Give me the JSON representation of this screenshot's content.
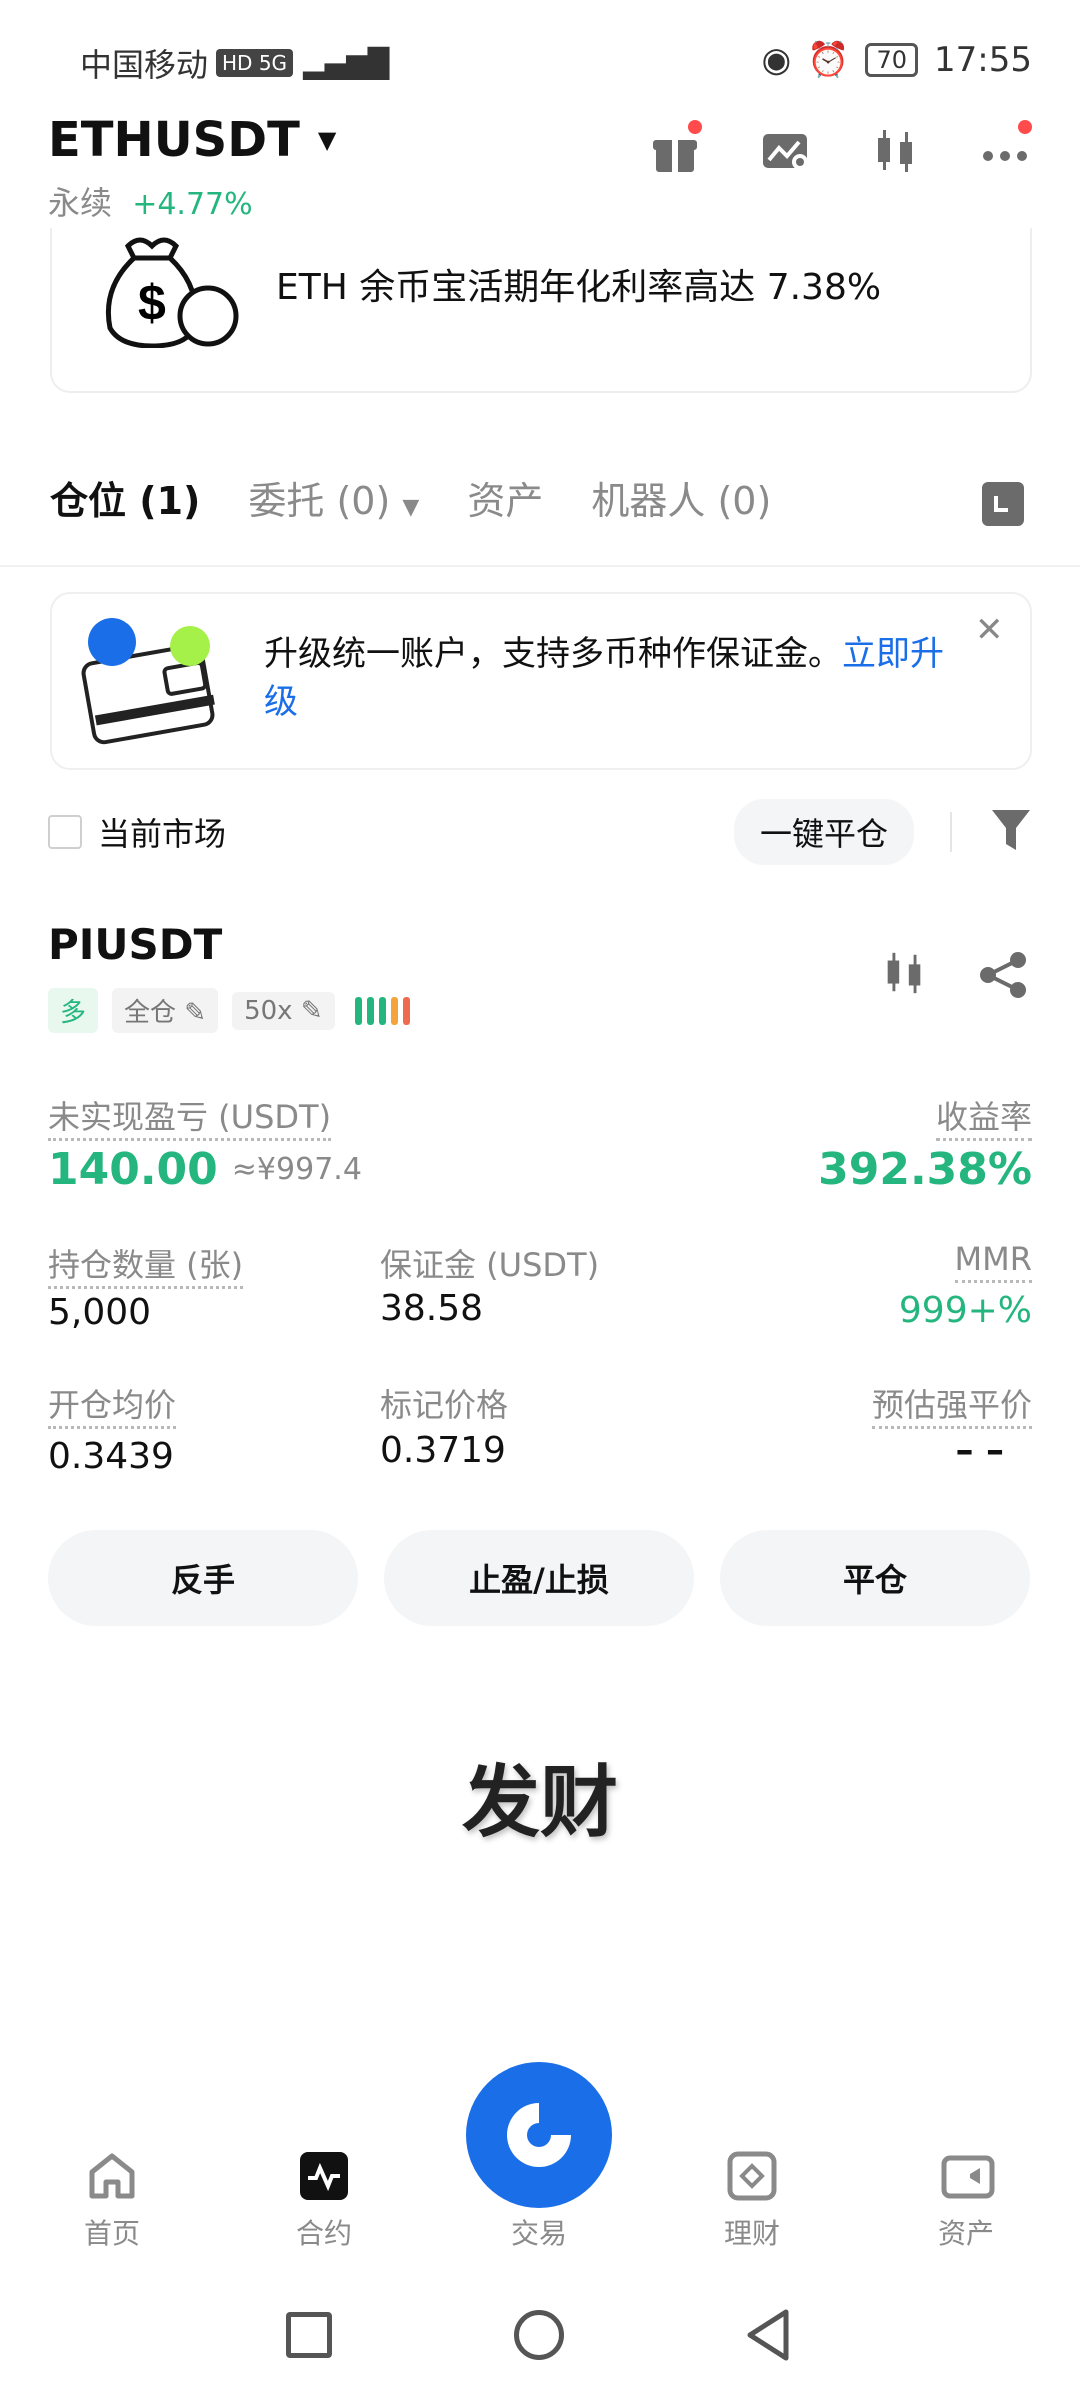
{
  "status_bar": {
    "carrier": "中国移动",
    "network": "HD 5G",
    "battery": "70",
    "time": "17:55"
  },
  "header": {
    "pair": "ETHUSDT",
    "contract_type": "永续",
    "change": "+4.77%"
  },
  "promo": {
    "text": "ETH 余币宝活期年化利率高达 7.38%"
  },
  "tabs": [
    {
      "label": "仓位 (1)"
    },
    {
      "label": "委托 (0)"
    },
    {
      "label": "资产"
    },
    {
      "label": "机器人 (0)"
    }
  ],
  "banner": {
    "text": "升级统一账户，支持多币种作保证金。",
    "link_text": "立即升级"
  },
  "filter": {
    "current_market": "当前市场",
    "close_all": "一键平仓"
  },
  "position": {
    "symbol": "PIUSDT",
    "side_tag": "多",
    "margin_mode": "全仓",
    "leverage": "50x",
    "unrealized_pnl_label": "未实现盈亏 (USDT)",
    "unrealized_pnl": "140.00",
    "unrealized_pnl_cny": "≈¥997.4",
    "roe_label": "收益率",
    "roe": "392.38%",
    "size_label": "持仓数量 (张)",
    "size": "5,000",
    "margin_label": "保证金 (USDT)",
    "margin": "38.58",
    "mmr_label": "MMR",
    "mmr": "999+%",
    "entry_label": "开仓均价",
    "entry": "0.3439",
    "mark_label": "标记价格",
    "mark": "0.3719",
    "liq_label": "预估强平价",
    "liq": "– –"
  },
  "actions": {
    "reverse": "反手",
    "tp_sl": "止盈/止损",
    "close": "平仓"
  },
  "watermark_text": "发财",
  "bottom_nav": [
    {
      "label": "首页"
    },
    {
      "label": "合约"
    },
    {
      "label": "交易"
    },
    {
      "label": "理财"
    },
    {
      "label": "资产"
    }
  ],
  "colors": {
    "brand_blue": "#1A6FE8",
    "profit_green": "#25B67F",
    "notify_red": "#FF4B4B"
  }
}
